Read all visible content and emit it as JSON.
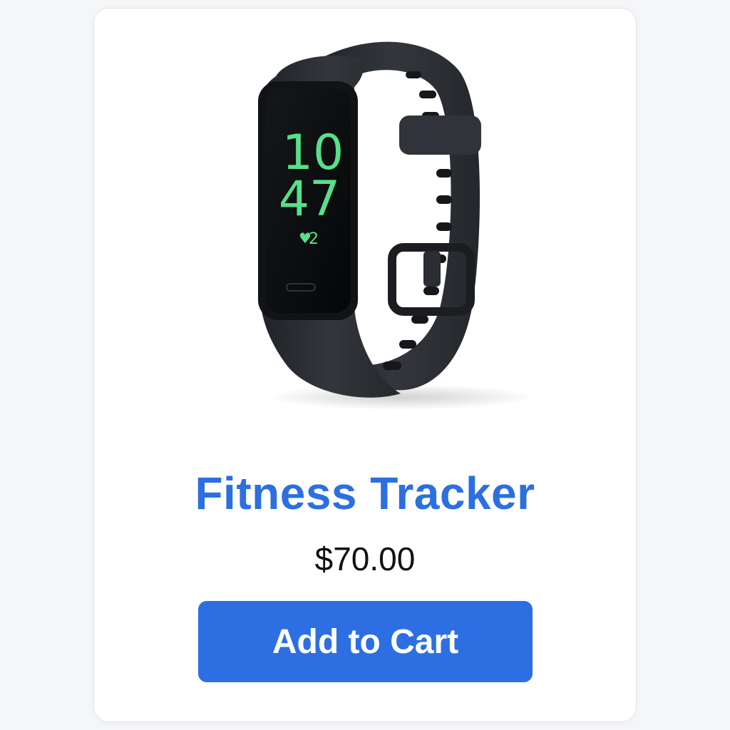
{
  "product": {
    "image_subject": "fitness-tracker-band",
    "screen": {
      "hour": "10",
      "minute": "47",
      "heart_glyph": "♥",
      "heart_value": "2"
    },
    "title": "Fitness Tracker",
    "price": "$70.00",
    "button_label": "Add to Cart"
  },
  "colors": {
    "title": "#2c6fe0",
    "button_bg": "#2d6fe3",
    "button_text": "#ffffff",
    "screen_digits": "#57e08a",
    "band": "#2a2d31"
  }
}
